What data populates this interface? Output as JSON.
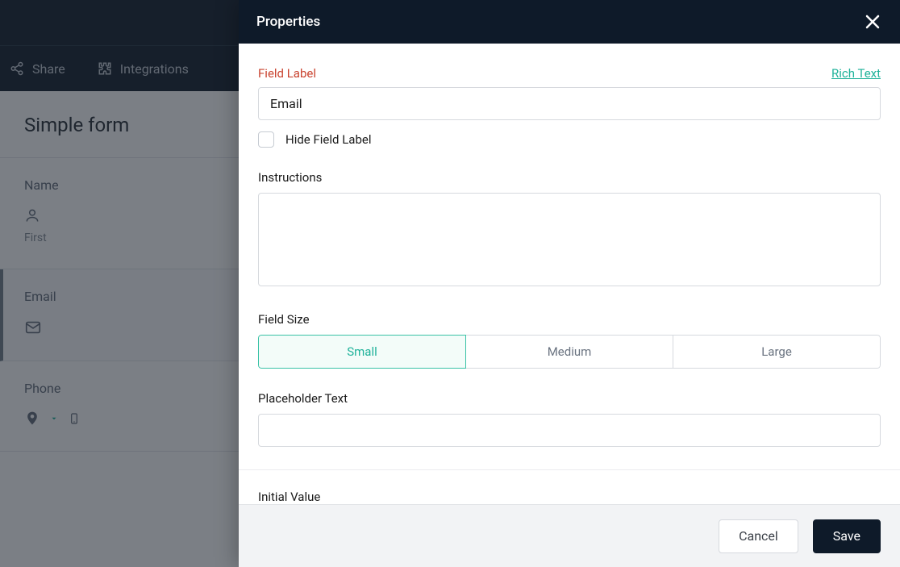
{
  "nav": {
    "share": "Share",
    "integrations": "Integrations"
  },
  "form": {
    "title": "Simple form",
    "fields": {
      "name": {
        "label": "Name",
        "sub": "First"
      },
      "email": {
        "label": "Email"
      },
      "phone": {
        "label": "Phone"
      }
    }
  },
  "panel": {
    "title": "Properties",
    "field_label_label": "Field Label",
    "rich_text": "Rich Text",
    "field_label_value": "Email",
    "hide_label": "Hide Field Label",
    "instructions_label": "Instructions",
    "instructions_value": "",
    "field_size_label": "Field Size",
    "sizes": {
      "small": "Small",
      "medium": "Medium",
      "large": "Large"
    },
    "placeholder_label": "Placeholder Text",
    "placeholder_value": "",
    "initial_value_label": "Initial Value",
    "footer": {
      "cancel": "Cancel",
      "save": "Save"
    }
  }
}
